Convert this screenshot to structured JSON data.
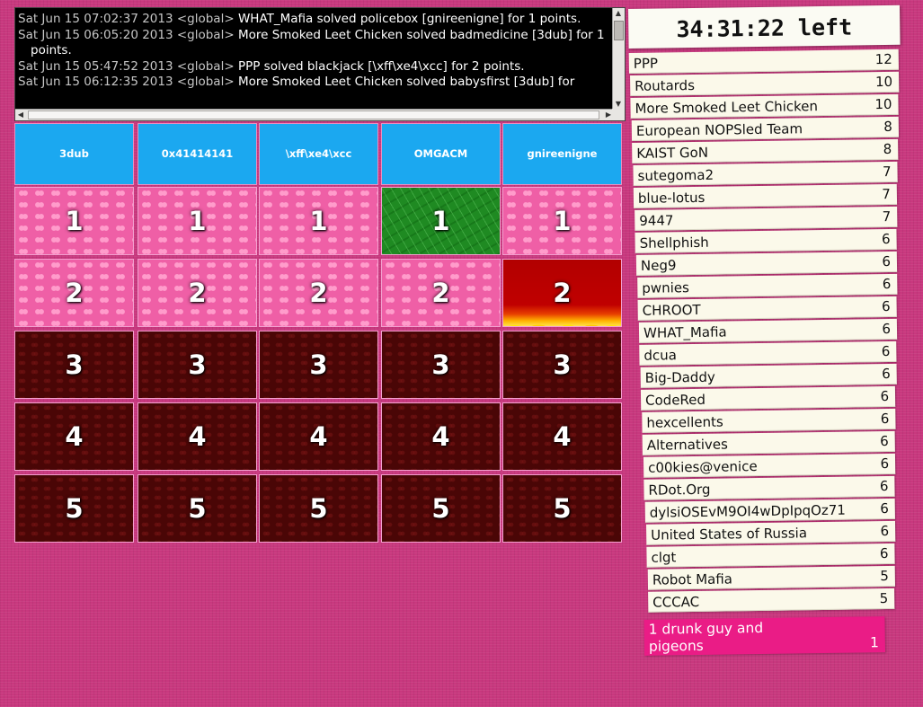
{
  "log": {
    "lines": [
      {
        "meta": "Sat Jun 15 07:02:37 2013 <global>",
        "text": "WHAT_Mafia solved policebox [gnireenigne] for 1 points."
      },
      {
        "meta": "Sat Jun 15 06:05:20 2013 <global>",
        "text": "More Smoked Leet Chicken solved badmedicine [3dub] for 1 points."
      },
      {
        "meta": "Sat Jun 15 05:47:52 2013 <global>",
        "text": "PPP solved blackjack [\\xff\\xe4\\xcc] for 2 points."
      },
      {
        "meta": "Sat Jun 15 06:12:35 2013 <global>",
        "text": "More Smoked Leet Chicken solved babysfirst [3dub] for"
      }
    ]
  },
  "board": {
    "categories": [
      "3dub",
      "0x41414141",
      "\\xff\\xe4\\xcc",
      "OMGACM",
      "gnireenigne"
    ],
    "rows": [
      {
        "label": "1",
        "states": [
          "open",
          "open",
          "open",
          "solved",
          "open"
        ]
      },
      {
        "label": "2",
        "states": [
          "open",
          "open",
          "open",
          "open",
          "fire"
        ]
      },
      {
        "label": "3",
        "states": [
          "locked",
          "locked",
          "locked",
          "locked",
          "locked"
        ]
      },
      {
        "label": "4",
        "states": [
          "locked",
          "locked",
          "locked",
          "locked",
          "locked"
        ]
      },
      {
        "label": "5",
        "states": [
          "locked",
          "locked",
          "locked",
          "locked",
          "locked"
        ]
      }
    ]
  },
  "scoreboard": {
    "timer": "34:31:22 left",
    "teams": [
      {
        "name": "PPP",
        "points": "12"
      },
      {
        "name": "Routards",
        "points": "10"
      },
      {
        "name": "More Smoked Leet Chicken",
        "points": "10"
      },
      {
        "name": "European NOPSled Team",
        "points": "8"
      },
      {
        "name": "KAIST GoN",
        "points": "8"
      },
      {
        "name": "sutegoma2",
        "points": "7"
      },
      {
        "name": "blue-lotus",
        "points": "7"
      },
      {
        "name": "9447",
        "points": "7"
      },
      {
        "name": "Shellphish",
        "points": "6"
      },
      {
        "name": "Neg9",
        "points": "6"
      },
      {
        "name": "pwnies",
        "points": "6"
      },
      {
        "name": "CHROOT",
        "points": "6"
      },
      {
        "name": "WHAT_Mafia",
        "points": "6"
      },
      {
        "name": "dcua",
        "points": "6"
      },
      {
        "name": "Big-Daddy",
        "points": "6"
      },
      {
        "name": "CodeRed",
        "points": "6"
      },
      {
        "name": "hexcellents",
        "points": "6"
      },
      {
        "name": "Alternatives",
        "points": "6"
      },
      {
        "name": "c00kies@venice",
        "points": "6"
      },
      {
        "name": "RDot.Org",
        "points": "6"
      },
      {
        "name": "dylsiOSEvM9OI4wDpIpqOz71",
        "points": "6"
      },
      {
        "name": "United States of Russia",
        "points": "6"
      },
      {
        "name": "clgt",
        "points": "6"
      },
      {
        "name": "Robot Mafia",
        "points": "5"
      },
      {
        "name": "CCCAC",
        "points": "5"
      },
      {
        "name": "1 drunk guy and pigeons",
        "points": "1",
        "highlight": true
      }
    ]
  },
  "colors": {
    "background": "#c8387e",
    "header": "#1ba8f0",
    "open_cell": "#ef5fa6",
    "solved_cell": "#1f8a22",
    "locked_cell": "#4a0606",
    "fire_cell": "#c00000",
    "highlight_team": "#ea1c86"
  }
}
